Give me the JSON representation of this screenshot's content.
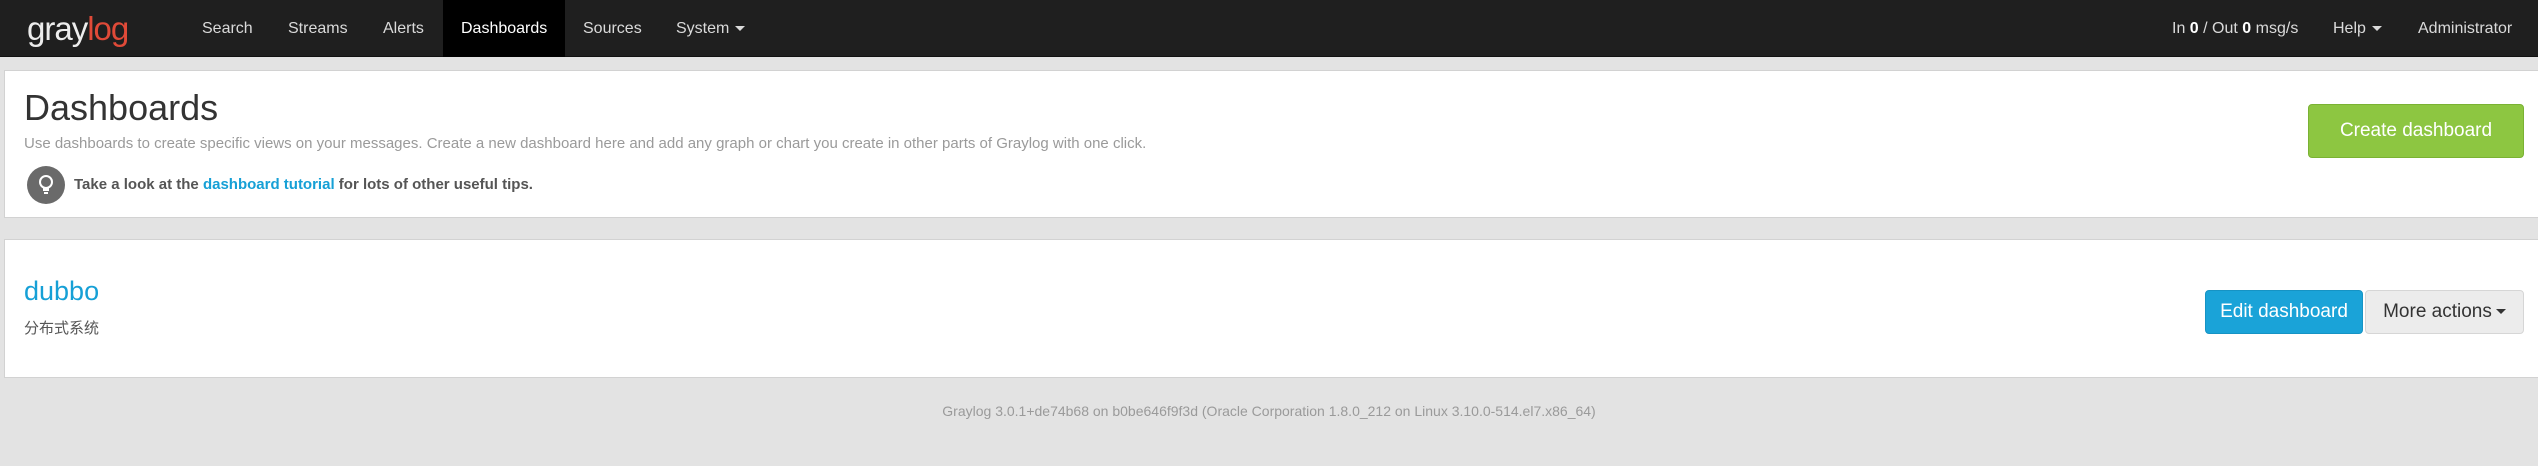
{
  "brand": {
    "logo_part1": "gray",
    "logo_part2": "log"
  },
  "nav": {
    "search": "Search",
    "streams": "Streams",
    "alerts": "Alerts",
    "dashboards": "Dashboards",
    "sources": "Sources",
    "system": "System",
    "throughput_in_label": "In",
    "throughput_in": "0",
    "throughput_sep": "/ Out",
    "throughput_out": "0",
    "throughput_unit": "msg/s",
    "help": "Help",
    "user": "Administrator"
  },
  "header": {
    "title": "Dashboards",
    "subtitle": "Use dashboards to create specific views on your messages. Create a new dashboard here and add any graph or chart you create in other parts of Graylog with one click.",
    "tip_prefix": "Take a look at the",
    "tip_link": "dashboard tutorial",
    "tip_suffix": "for lots of other useful tips.",
    "create_button": "Create dashboard"
  },
  "dashboards": [
    {
      "title": "dubbo",
      "description": "分布式系统",
      "edit_button": "Edit dashboard",
      "more_button": "More actions"
    }
  ],
  "footer": {
    "version": "Graylog 3.0.1+de74b68 on b0be646f9f3d (Oracle Corporation 1.8.0_212 on Linux 3.10.0-514.el7.x86_64)"
  },
  "colors": {
    "navbar": "#1f1f1f",
    "accent_blue": "#16a0d6",
    "create_green": "#8dc641",
    "logo_red": "#e04a38"
  }
}
